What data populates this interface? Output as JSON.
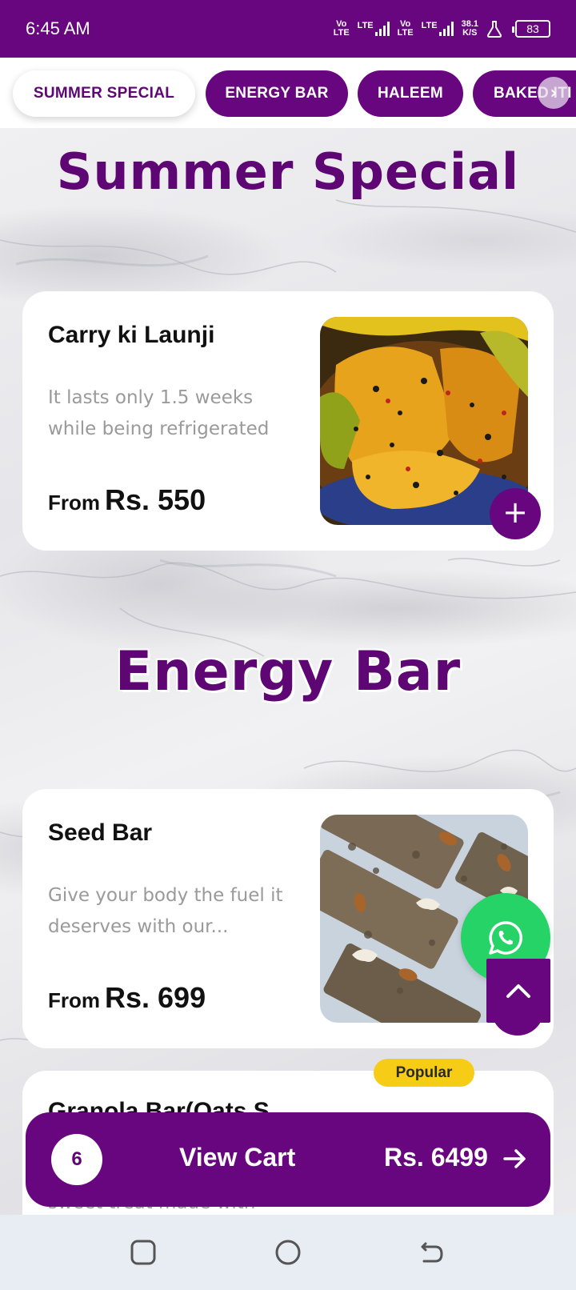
{
  "status_bar": {
    "time": "6:45 AM",
    "net1_top": "Vo",
    "net1_bottom": "LTE",
    "net2": "LTE",
    "net3_top": "Vo",
    "net3_bottom": "LTE",
    "net4": "LTE",
    "speed_value": "38.1",
    "speed_unit": "K/S",
    "battery": "83"
  },
  "tabs": [
    {
      "label": "SUMMER SPECIAL",
      "active": true
    },
    {
      "label": "ENERGY BAR",
      "active": false
    },
    {
      "label": "HALEEM",
      "active": false
    },
    {
      "label": "BAKED ITI",
      "active": false
    }
  ],
  "sections": [
    {
      "title": "Summer Special"
    },
    {
      "title": "Energy Bar"
    }
  ],
  "products": [
    {
      "name": "Carry ki Launji",
      "description": "It lasts only 1.5 weeks while being refrigerated",
      "price_prefix": "From",
      "price": "Rs. 550"
    },
    {
      "name": "Seed Bar",
      "description": "Give your body the fuel it deserves with our...",
      "price_prefix": "From",
      "price": "Rs. 699"
    },
    {
      "badge": "Popular",
      "name": "Granola Bar(Oats S",
      "description": "sweet treat made with"
    }
  ],
  "cart": {
    "count": "6",
    "label": "View Cart",
    "total": "Rs. 6499"
  },
  "colors": {
    "brand_purple": "#68067f",
    "popular_yellow": "#f7cc16",
    "whatsapp_green": "#25d366"
  },
  "icons": [
    "plus-icon",
    "whatsapp-icon",
    "chevron-up-icon",
    "arrow-right-icon",
    "recent-apps-icon",
    "home-icon",
    "back-icon"
  ]
}
